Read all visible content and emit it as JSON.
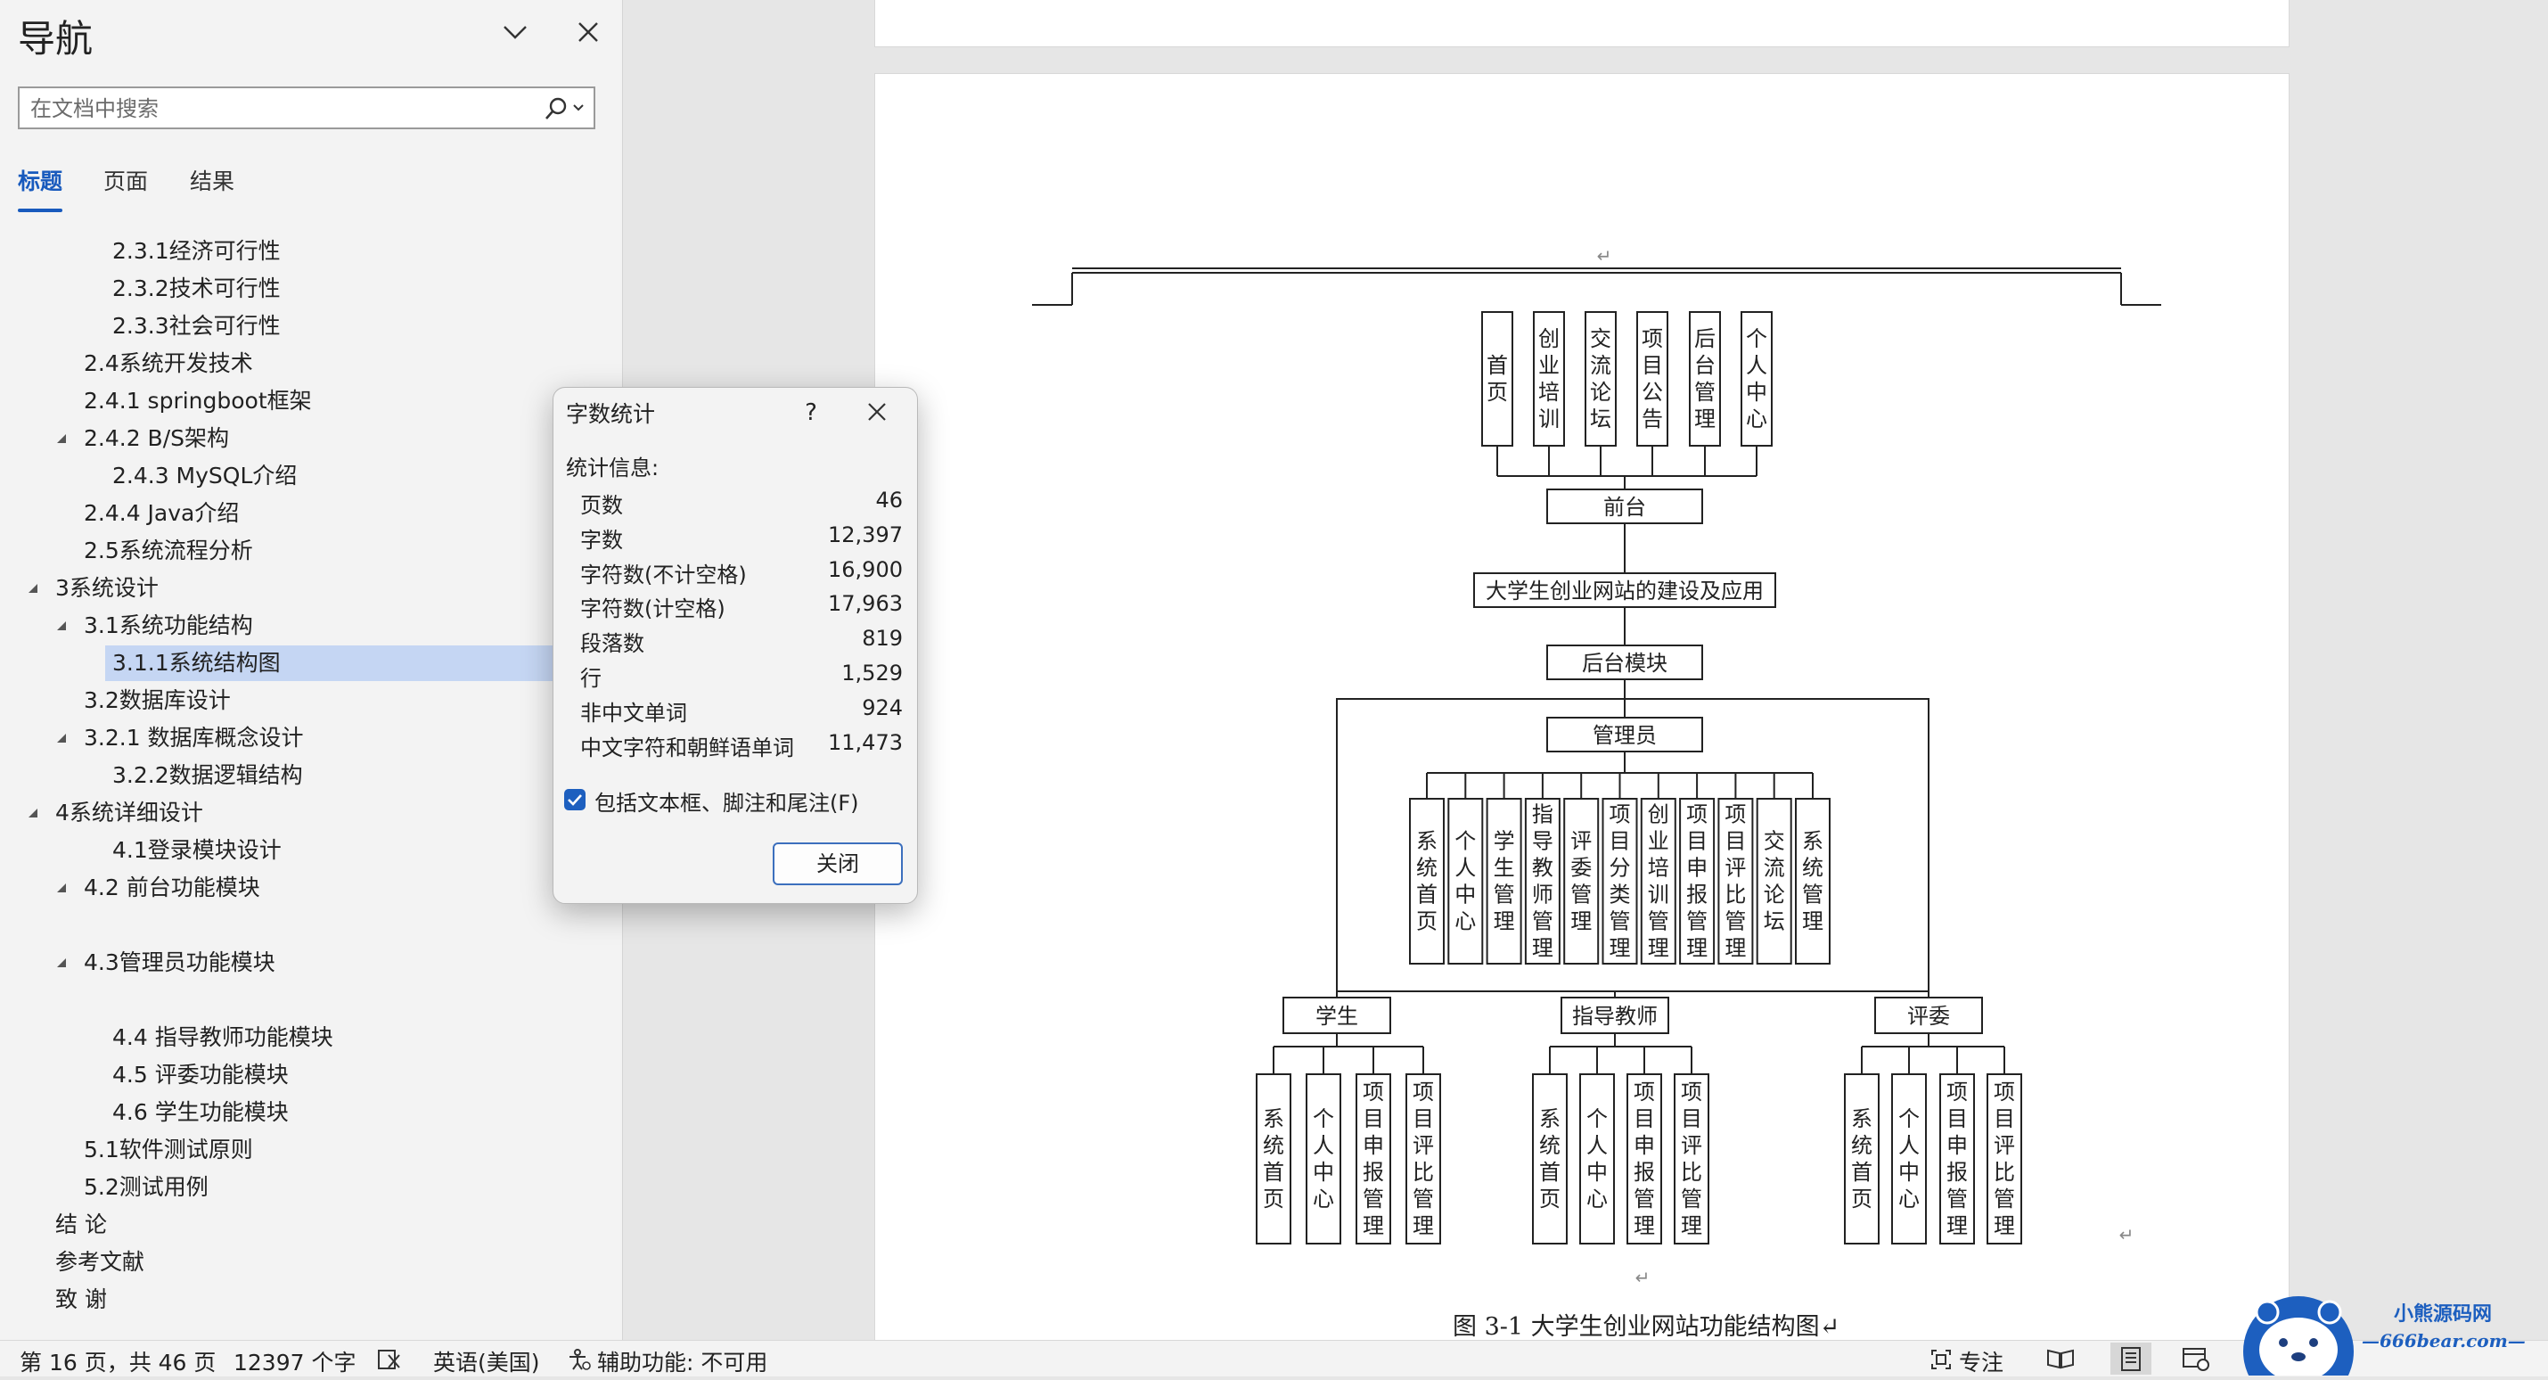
{
  "nav": {
    "title": "导航",
    "search_placeholder": "在文档中搜索",
    "tabs": [
      "标题",
      "页面",
      "结果"
    ],
    "items": [
      {
        "label": "2.3.1经济可行性",
        "level": 3,
        "caret": false,
        "selected": false
      },
      {
        "label": "2.3.2技术可行性",
        "level": 3,
        "caret": false,
        "selected": false
      },
      {
        "label": "2.3.3社会可行性",
        "level": 3,
        "caret": false,
        "selected": false
      },
      {
        "label": "2.4系统开发技术",
        "level": 2,
        "caret": false,
        "selected": false
      },
      {
        "label": "2.4.1 springboot框架",
        "level": 2,
        "caret": false,
        "selected": false
      },
      {
        "label": "2.4.2 B/S架构",
        "level": 2,
        "caret": true,
        "selected": false
      },
      {
        "label": "2.4.3 MySQL介绍",
        "level": 3,
        "caret": false,
        "selected": false
      },
      {
        "label": "2.4.4 Java介绍",
        "level": 2,
        "caret": false,
        "selected": false
      },
      {
        "label": "2.5系统流程分析",
        "level": 2,
        "caret": false,
        "selected": false
      },
      {
        "label": "3系统设计",
        "level": 1,
        "caret": true,
        "selected": false
      },
      {
        "label": "3.1系统功能结构",
        "level": 2,
        "caret": true,
        "selected": false
      },
      {
        "label": "3.1.1系统结构图",
        "level": 3,
        "caret": false,
        "selected": true
      },
      {
        "label": "3.2数据库设计",
        "level": 2,
        "caret": false,
        "selected": false
      },
      {
        "label": "3.2.1 数据库概念设计",
        "level": 2,
        "caret": true,
        "selected": false
      },
      {
        "label": "3.2.2数据逻辑结构",
        "level": 3,
        "caret": false,
        "selected": false
      },
      {
        "label": "4系统详细设计",
        "level": 1,
        "caret": true,
        "selected": false
      },
      {
        "label": "4.1登录模块设计",
        "level": 3,
        "caret": false,
        "selected": false
      },
      {
        "label": "4.2 前台功能模块",
        "level": 2,
        "caret": true,
        "selected": false
      },
      {
        "label": "",
        "level": 2,
        "caret": false,
        "selected": false
      },
      {
        "label": "4.3管理员功能模块",
        "level": 2,
        "caret": true,
        "selected": false
      },
      {
        "label": "",
        "level": 2,
        "caret": false,
        "selected": false
      },
      {
        "label": "4.4 指导教师功能模块",
        "level": 3,
        "caret": false,
        "selected": false
      },
      {
        "label": "4.5 评委功能模块",
        "level": 3,
        "caret": false,
        "selected": false
      },
      {
        "label": "4.6 学生功能模块",
        "level": 3,
        "caret": false,
        "selected": false
      },
      {
        "label": "5.1软件测试原则",
        "level": 2,
        "caret": false,
        "selected": false
      },
      {
        "label": "5.2测试用例",
        "level": 2,
        "caret": false,
        "selected": false
      },
      {
        "label": "结 论",
        "level": 1,
        "caret": false,
        "selected": false
      },
      {
        "label": "参考文献",
        "level": 1,
        "caret": false,
        "selected": false
      },
      {
        "label": "致 谢",
        "level": 1,
        "caret": false,
        "selected": false
      }
    ]
  },
  "dialog": {
    "title": "字数统计",
    "help": "?",
    "section": "统计信息:",
    "stats": [
      {
        "label": "页数",
        "value": "46"
      },
      {
        "label": "字数",
        "value": "12,397"
      },
      {
        "label": "字符数(不计空格)",
        "value": "16,900"
      },
      {
        "label": "字符数(计空格)",
        "value": "17,963"
      },
      {
        "label": "段落数",
        "value": "819"
      },
      {
        "label": "行",
        "value": "1,529"
      },
      {
        "label": "非中文单词",
        "value": "924"
      },
      {
        "label": "中文字符和朝鲜语单词",
        "value": "11,473"
      }
    ],
    "include_label": "包括文本框、脚注和尾注(F)",
    "include_checked": true,
    "close_label": "关闭"
  },
  "diagram": {
    "root": "大学生创业网站的建设及应用",
    "front": "前台",
    "front_children": [
      "首页",
      "创业培训",
      "交流论坛",
      "项目公告",
      "后台管理",
      "个人中心"
    ],
    "back": "后台模块",
    "admin": "管理员",
    "admin_children": [
      "系统首页",
      "个人中心",
      "学生管理",
      "指导教师管理",
      "评委管理",
      "项目分类管理",
      "创业培训管理",
      "项目申报管理",
      "项目评比管理",
      "交流论坛",
      "系统管理"
    ],
    "roles": [
      {
        "name": "学生",
        "children": [
          "系统首页",
          "个人中心",
          "项目申报管理",
          "项目评比管理"
        ]
      },
      {
        "name": "指导教师",
        "children": [
          "系统首页",
          "个人中心",
          "项目申报管理",
          "项目评比管理"
        ]
      },
      {
        "name": "评委",
        "children": [
          "系统首页",
          "个人中心",
          "项目申报管理",
          "项目评比管理"
        ]
      }
    ],
    "para_mark": "↵"
  },
  "caption": "图 3-1  大学生创业网站功能结构图↵",
  "status": {
    "page": "第 16 页，共 46 页",
    "words": "12397 个字",
    "language": "英语(美国)",
    "accessibility": "辅助功能: 不可用",
    "focus": "专注"
  },
  "logo": {
    "name": "小熊源码网",
    "url": "—666bear.com—"
  },
  "colors": {
    "accent": "#185abd",
    "selection": "#c5d6f3",
    "checkbox": "#1d5fbf"
  }
}
